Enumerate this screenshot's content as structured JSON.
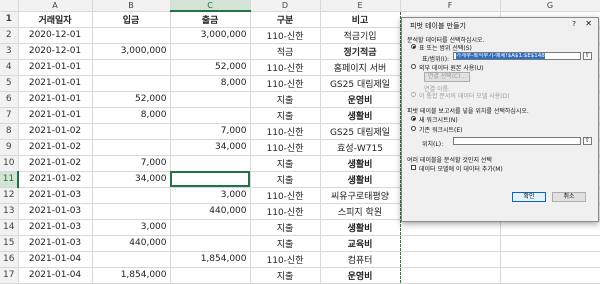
{
  "columns": [
    "A",
    "B",
    "C",
    "D",
    "E",
    "F",
    "G"
  ],
  "header_row": {
    "num": "1",
    "a": "거래일자",
    "b": "입금",
    "c": "출금",
    "d": "구분",
    "e": "비고"
  },
  "rows": [
    {
      "num": "2",
      "a": "2020-12-01",
      "b": "",
      "c": "3,000,000",
      "d": "110-신한",
      "e": "적금기입"
    },
    {
      "num": "3",
      "a": "2020-12-01",
      "b": "3,000,000",
      "c": "",
      "d": "적금",
      "e": "정기적금"
    },
    {
      "num": "4",
      "a": "2021-01-01",
      "b": "",
      "c": "52,000",
      "d": "110-신한",
      "e": "홈페이지 서버"
    },
    {
      "num": "5",
      "a": "2021-01-01",
      "b": "",
      "c": "8,000",
      "d": "110-신한",
      "e": "GS25 대림제일"
    },
    {
      "num": "6",
      "a": "2021-01-01",
      "b": "52,000",
      "c": "",
      "d": "지출",
      "e": "운영비"
    },
    {
      "num": "7",
      "a": "2021-01-01",
      "b": "8,000",
      "c": "",
      "d": "지출",
      "e": "생활비"
    },
    {
      "num": "8",
      "a": "2021-01-02",
      "b": "",
      "c": "7,000",
      "d": "110-신한",
      "e": "GS25 대림제일"
    },
    {
      "num": "9",
      "a": "2021-01-02",
      "b": "",
      "c": "34,000",
      "d": "110-신한",
      "e": "효성-W715"
    },
    {
      "num": "10",
      "a": "2021-01-02",
      "b": "7,000",
      "c": "",
      "d": "지출",
      "e": "생활비"
    },
    {
      "num": "11",
      "a": "2021-01-02",
      "b": "34,000",
      "c": "",
      "d": "지출",
      "e": "생활비"
    },
    {
      "num": "12",
      "a": "2021-01-03",
      "b": "",
      "c": "3,000",
      "d": "110-신한",
      "e": "씨유구로태평양"
    },
    {
      "num": "13",
      "a": "2021-01-03",
      "b": "",
      "c": "440,000",
      "d": "110-신한",
      "e": "스피지 학원"
    },
    {
      "num": "14",
      "a": "2021-01-03",
      "b": "3,000",
      "c": "",
      "d": "지출",
      "e": "생활비"
    },
    {
      "num": "15",
      "a": "2021-01-03",
      "b": "440,000",
      "c": "",
      "d": "지출",
      "e": "교육비"
    },
    {
      "num": "16",
      "a": "2021-01-04",
      "b": "",
      "c": "1,854,000",
      "d": "110-신한",
      "e": "컴퓨터"
    },
    {
      "num": "17",
      "a": "2021-01-04",
      "b": "1,854,000",
      "c": "",
      "d": "지출",
      "e": "운영비"
    }
  ],
  "dialog": {
    "title": "피벗 테이블 만들기",
    "help": "?",
    "close": "✕",
    "section1": "분석할 데이터를 선택하십시오.",
    "opt_range": "표 또는 범위 선택(S)",
    "range_label": "표/범위(I):",
    "range_value": "가계부-복식부기-예제!$A$1:$E$148",
    "opt_external": "외부 데이터 원본 사용(U)",
    "conn_button": "연결 선택(C)...",
    "conn_name": "연결 이름:",
    "datamodel": "이 통합 문서의 데이터 모델 사용(D)",
    "section2": "피벗 테이블 보고서를 넣을 위치를 선택하십시오.",
    "opt_new": "새 워크시트(N)",
    "opt_existing": "기존 워크시트(E)",
    "location_label": "위치(L):",
    "section3": "여러 테이블을 분석할 것인지 선택",
    "add_model": "데이터 모델에 이 데이터 추가(M)",
    "ok": "확인",
    "cancel": "취소"
  }
}
